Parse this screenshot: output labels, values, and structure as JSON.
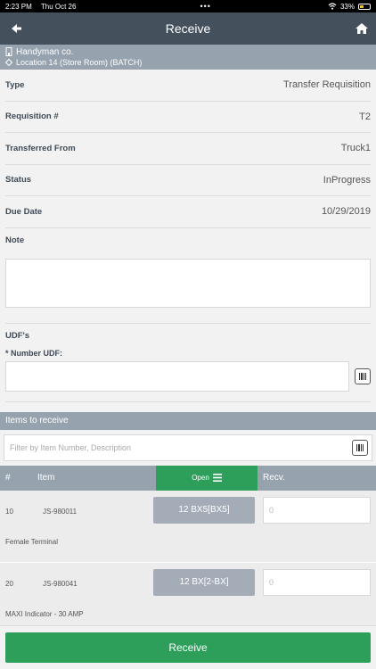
{
  "status_bar": {
    "time": "2:23 PM",
    "date": "Thu Oct 26",
    "dots": "•••",
    "battery": "33%"
  },
  "nav": {
    "title": "Receive"
  },
  "company": {
    "name": "Handyman co.",
    "location": "Location 14 (Store Room)  (BATCH)"
  },
  "fields": [
    {
      "label": "Type",
      "value": "Transfer Requisition"
    },
    {
      "label": "Requisition #",
      "value": "T2"
    },
    {
      "label": "Transferred From",
      "value": "Truck1"
    },
    {
      "label": "Status",
      "value": "InProgress"
    },
    {
      "label": "Due Date",
      "value": "10/29/2019"
    }
  ],
  "note": {
    "label": "Note",
    "value": ""
  },
  "udf": {
    "section_label": "UDF's",
    "field_label": "* Number UDF:",
    "value": ""
  },
  "items": {
    "header": "Items to receive",
    "filter_placeholder": "Filter by Item Number, Description",
    "columns": {
      "num": "#",
      "item": "Item",
      "open": "Open",
      "recv": "Recv."
    },
    "rows": [
      {
        "num": "10",
        "code": "JS-980011",
        "qty": "12 BX5[BX5]",
        "recv_placeholder": "0",
        "desc": "Female Terminal"
      },
      {
        "num": "20",
        "code": "JS-980041",
        "qty": "12 BX[2-BX]",
        "recv_placeholder": "0",
        "desc": "MAXI Indicator - 30 AMP"
      }
    ]
  },
  "footer": {
    "receive_label": "Receive"
  },
  "colors": {
    "navbar": "#45505d",
    "section": "#96a2ae",
    "accent_green": "#2e9e5b",
    "qty_button": "#a4adb7"
  }
}
